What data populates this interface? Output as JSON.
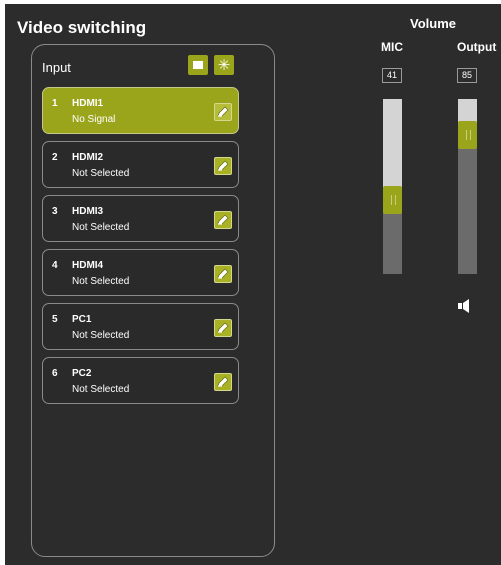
{
  "video_switching": {
    "title": "Video switching",
    "input_label": "Input",
    "view_buttons": [
      {
        "name": "list-view",
        "icon": "list-view-icon"
      },
      {
        "name": "grid-view",
        "icon": "grid-view-icon"
      }
    ],
    "inputs": [
      {
        "index": "1",
        "name": "HDMI1",
        "status": "No Signal",
        "active": true
      },
      {
        "index": "2",
        "name": "HDMI2",
        "status": "Not Selected",
        "active": false
      },
      {
        "index": "3",
        "name": "HDMI3",
        "status": "Not Selected",
        "active": false
      },
      {
        "index": "4",
        "name": "HDMI4",
        "status": "Not Selected",
        "active": false
      },
      {
        "index": "5",
        "name": "PC1",
        "status": "Not Selected",
        "active": false
      },
      {
        "index": "6",
        "name": "PC2",
        "status": "Not Selected",
        "active": false
      }
    ]
  },
  "volume": {
    "title": "Volume",
    "mic": {
      "label": "MIC",
      "value": "41",
      "level": 0.41
    },
    "output": {
      "label": "Output",
      "value": "85",
      "level": 0.85
    },
    "speaker_icon": "speaker-icon"
  },
  "colors": {
    "accent": "#9aa51c",
    "background": "#2c2c2c",
    "border": "#8a8a8a"
  }
}
